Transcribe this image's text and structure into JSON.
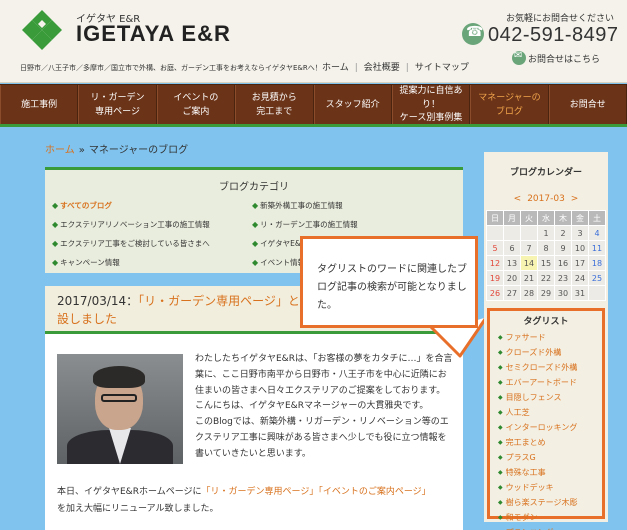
{
  "header": {
    "logo_sub": "イゲタヤ E&R",
    "logo_main": "IGETAYA E&R",
    "tagline": "日野市／八王子市／多摩市／国立市で外構、お庭、ガーデン工事をお考えならイゲタヤE&Rへ！",
    "top_nav": [
      "ホーム",
      "会社概要",
      "サイトマップ"
    ],
    "call_label": "お気軽にお問合せください",
    "phone": "042-591-8497",
    "contact_link": "お問合せはこちら"
  },
  "main_nav": [
    {
      "label": "施工事例",
      "active": false
    },
    {
      "label": "リ・ガーデン\n専用ページ",
      "active": false
    },
    {
      "label": "イベントの\nご案内",
      "active": false
    },
    {
      "label": "お見積から\n完工まで",
      "active": false
    },
    {
      "label": "スタッフ紹介",
      "active": false
    },
    {
      "label": "提案力に自信あり！\nケース別事例集",
      "active": false
    },
    {
      "label": "マネージャーの\nブログ",
      "active": true
    },
    {
      "label": "お問合せ",
      "active": false
    }
  ],
  "breadcrumb": {
    "home": "ホーム",
    "sep": "»",
    "current": "マネージャーのブログ"
  },
  "category": {
    "title": "ブログカテゴリ",
    "left": [
      "すべてのブログ",
      "エクステリアリノベーション工事の施工情報",
      "エクステリア工事をご検討している皆さまへ",
      "キャンペーン情報"
    ],
    "right": [
      "新築外構工事の施工情報",
      "リ・ガーデン工事の施工情報",
      "イゲタヤE&R",
      "イベント情報"
    ]
  },
  "article": {
    "date": "2017/03/14：",
    "title": "「リ・ガーデン専用ページ」と「イベントのご案内」ページを新設しました",
    "title_line1": "「リ・ガーデン専用ページ」と",
    "title_line2": "設しました",
    "para1": "わたしたちイゲタヤE&Rは、「お客様の夢をカタチに…」を合言葉に、ここ日野市南平から日野市・八王子市を中心に近隣にお住まいの皆さまへ日々エクステリアのご提案をしております。",
    "para2": "こんにちは、イゲタヤE&Rマネージャーの大貫雅央です。",
    "para3": "このBlogでは、新築外構・リガーデン・リノベーション等のエクステリア工事に興味がある皆さまへ少しでも役に立つ情報を書いていきたいと思います。",
    "para4_pre": "本日、イゲタヤE&Rホームページに",
    "para4_link1": "「リ・ガーデン専用ページ」",
    "para4_link2": "「イベントのご案内ページ」",
    "para4_post": "を加え大幅にリニューアル致しました。"
  },
  "callout": {
    "text": "タグリストのワードに関連したブログ記事の検索が可能となりました。"
  },
  "sidebar": {
    "calendar_title": "ブログカレンダー",
    "month": "2017-03",
    "prev": "<",
    "next": ">",
    "weekdays": [
      "日",
      "月",
      "火",
      "水",
      "木",
      "金",
      "土"
    ],
    "weeks": [
      [
        "",
        "",
        "",
        "1",
        "2",
        "3",
        "4"
      ],
      [
        "5",
        "6",
        "7",
        "8",
        "9",
        "10",
        "11"
      ],
      [
        "12",
        "13",
        "14",
        "15",
        "16",
        "17",
        "18"
      ],
      [
        "19",
        "20",
        "21",
        "22",
        "23",
        "24",
        "25"
      ],
      [
        "26",
        "27",
        "28",
        "29",
        "30",
        "31",
        ""
      ]
    ],
    "tag_title": "タグリスト",
    "tags": [
      "ファサード",
      "クローズド外構",
      "セミクローズド外構",
      "エバーアートボード",
      "目隠しフェンス",
      "人工芝",
      "インターロッキング",
      "完工まとめ",
      "プラスG",
      "特殊な工事",
      "ウッドデッキ",
      "樹ら楽ステージ木彫",
      "和モダン",
      "プランニング"
    ]
  },
  "colors": {
    "accent": "#d8721e",
    "nav_bg": "#6b3419",
    "green": "#3a9b3a",
    "callout_border": "#e76f2a"
  }
}
